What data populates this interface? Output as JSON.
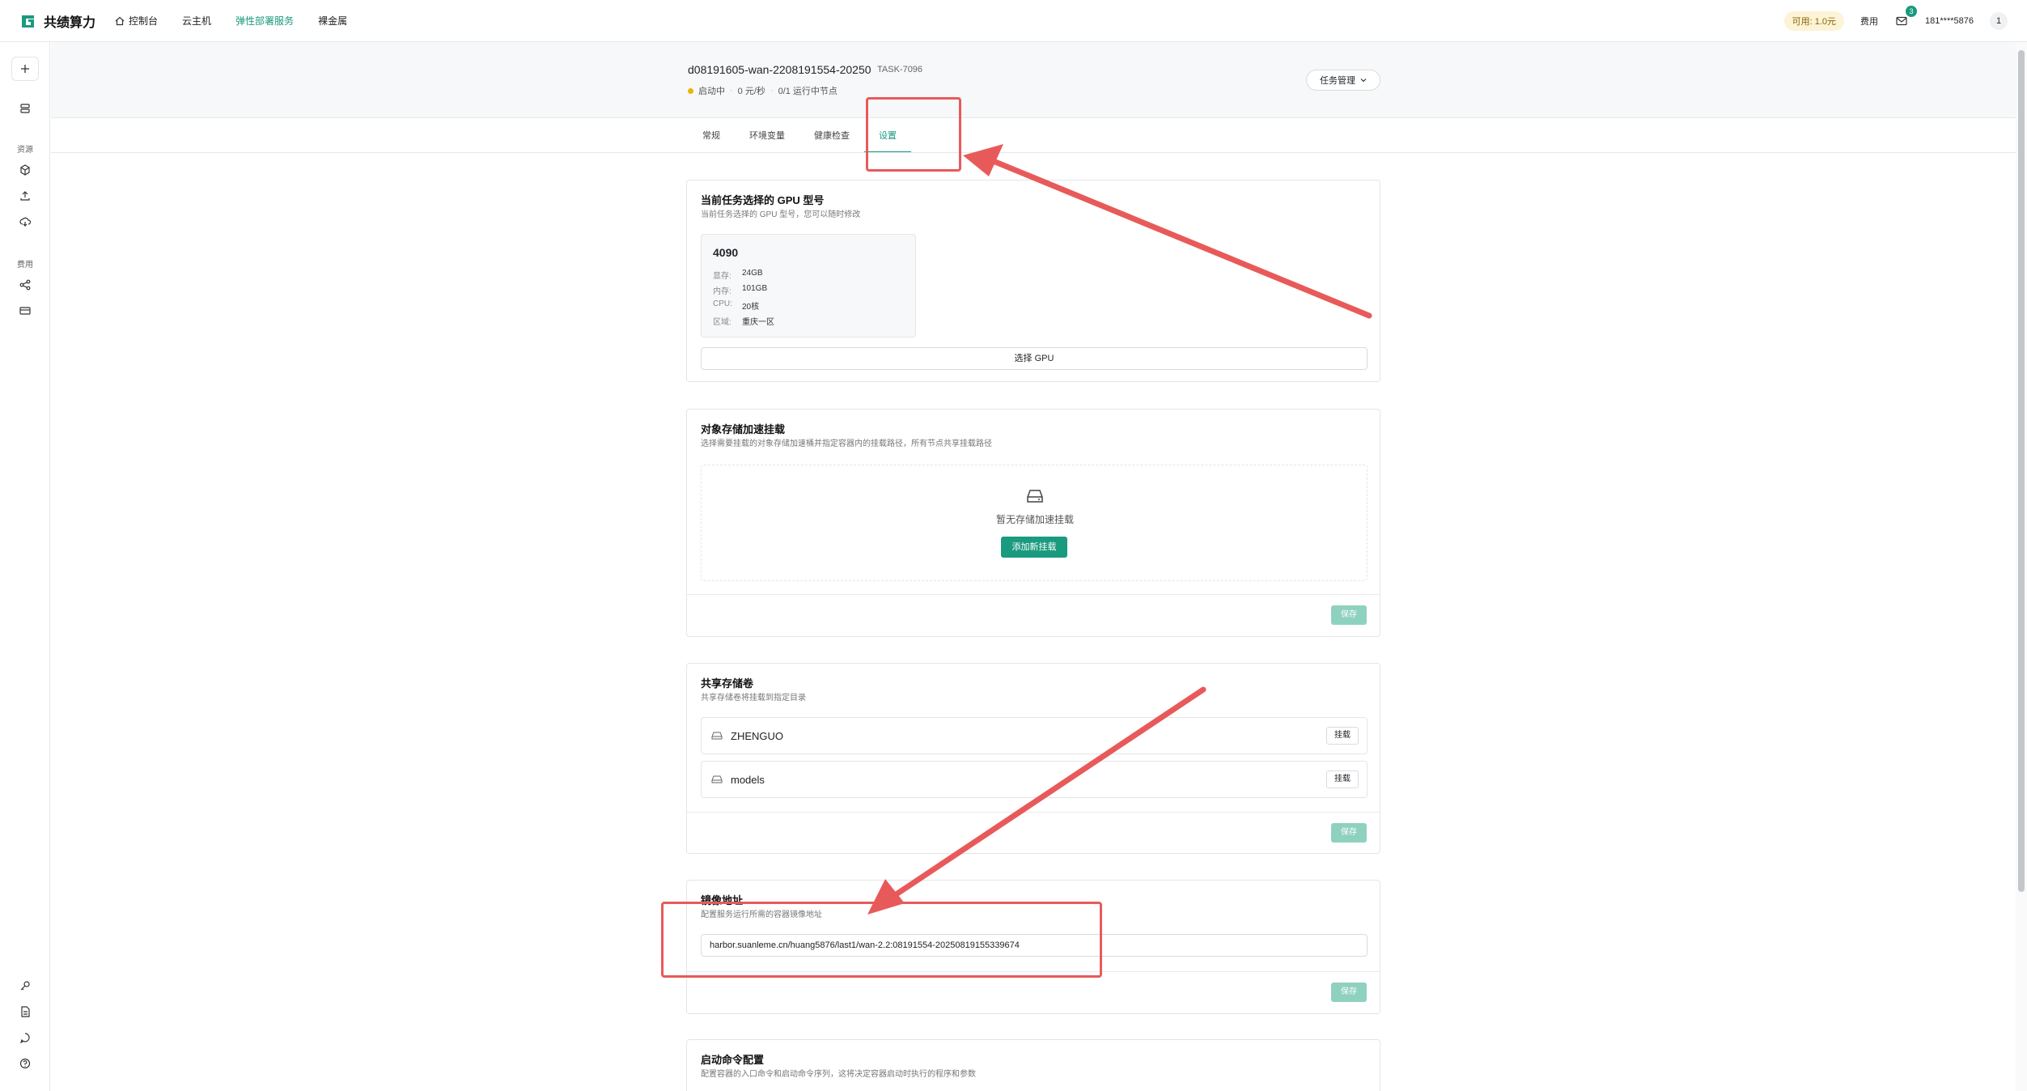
{
  "brand": {
    "name": "共绩算力"
  },
  "nav": {
    "items": [
      "控制台",
      "云主机",
      "弹性部署服务",
      "裸金属"
    ],
    "active_index": 2
  },
  "topright": {
    "balance": "可用: 1.0元",
    "fee": "费用",
    "mail_count": "3",
    "user": "181****5876",
    "avatar": "1"
  },
  "sidebar": {
    "section_resources": "资源",
    "section_fees": "费用"
  },
  "task": {
    "title": "d08191605-wan-2208191554-20250",
    "code": "TASK-7096",
    "status": "启动中",
    "price": "0 元/秒",
    "nodes": "0/1 运行中节点",
    "manage_btn": "任务管理"
  },
  "tabs": [
    "常规",
    "环境变量",
    "健康检查",
    "设置"
  ],
  "active_tab": 3,
  "gpu_card": {
    "title": "当前任务选择的 GPU 型号",
    "desc": "当前任务选择的 GPU 型号，您可以随时修改",
    "gpu_name": "4090",
    "specs": [
      {
        "k": "显存:",
        "v": "24GB"
      },
      {
        "k": "内存:",
        "v": "101GB"
      },
      {
        "k": "CPU:",
        "v": "20核"
      },
      {
        "k": "区域:",
        "v": "重庆一区"
      }
    ],
    "select_btn": "选择 GPU"
  },
  "storage_card": {
    "title": "对象存储加速挂载",
    "desc": "选择需要挂载的对象存储加速桶并指定容器内的挂载路径，所有节点共享挂载路径",
    "empty_text": "暂无存储加速挂载",
    "add_btn": "添加新挂载",
    "save_btn": "保存"
  },
  "volume_card": {
    "title": "共享存储卷",
    "desc": "共享存储卷将挂载到指定目录",
    "volumes": [
      {
        "name": "ZHENGUO",
        "btn": "挂载"
      },
      {
        "name": "models",
        "btn": "挂载"
      }
    ],
    "save_btn": "保存"
  },
  "image_card": {
    "title": "镜像地址",
    "desc": "配置服务运行所需的容器镜像地址",
    "value": "harbor.suanleme.cn/huang5876/last1/wan-2.2:08191554-20250819155339674",
    "save_btn": "保存"
  },
  "cmd_card": {
    "title": "启动命令配置",
    "desc": "配置容器的入口命令和启动命令序列，这将决定容器启动时执行的程序和参数"
  },
  "colors": {
    "accent": "#1a9a7e",
    "annotation": "#e85a5a",
    "status_dot": "#e8b500"
  }
}
